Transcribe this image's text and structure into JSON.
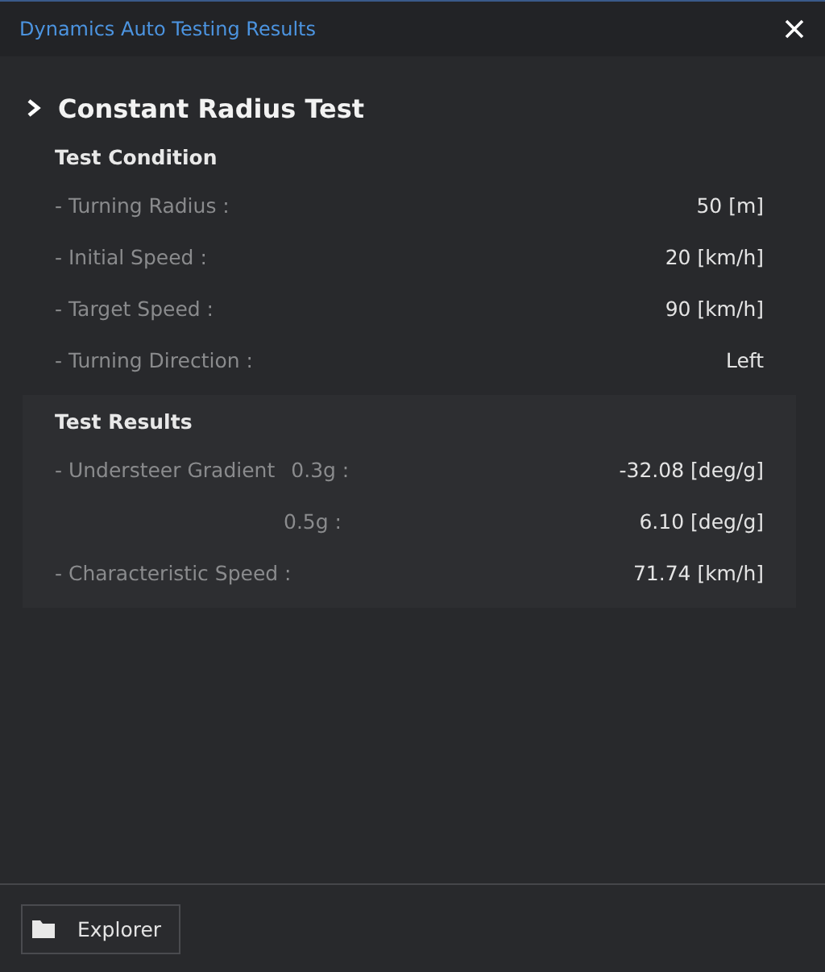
{
  "window": {
    "title": "Dynamics Auto Testing Results"
  },
  "section": {
    "title": "Constant Radius Test"
  },
  "condition": {
    "heading": "Test Condition",
    "rows": [
      {
        "label": "- Turning Radius :",
        "value": "50 [m]"
      },
      {
        "label": "- Initial Speed :",
        "value": "20 [km/h]"
      },
      {
        "label": "- Target Speed :",
        "value": "90 [km/h]"
      },
      {
        "label": "- Turning Direction :",
        "value": "Left"
      }
    ]
  },
  "results": {
    "heading": "Test Results",
    "rows": [
      {
        "label": "- Understeer Gradient",
        "sublabel": "0.3g :",
        "value": "-32.08 [deg/g]"
      },
      {
        "sublabel": "0.5g :",
        "value": "6.10 [deg/g]"
      },
      {
        "label": "- Characteristic Speed :",
        "value": "71.74 [km/h]"
      }
    ]
  },
  "footer": {
    "button": "Explorer"
  }
}
